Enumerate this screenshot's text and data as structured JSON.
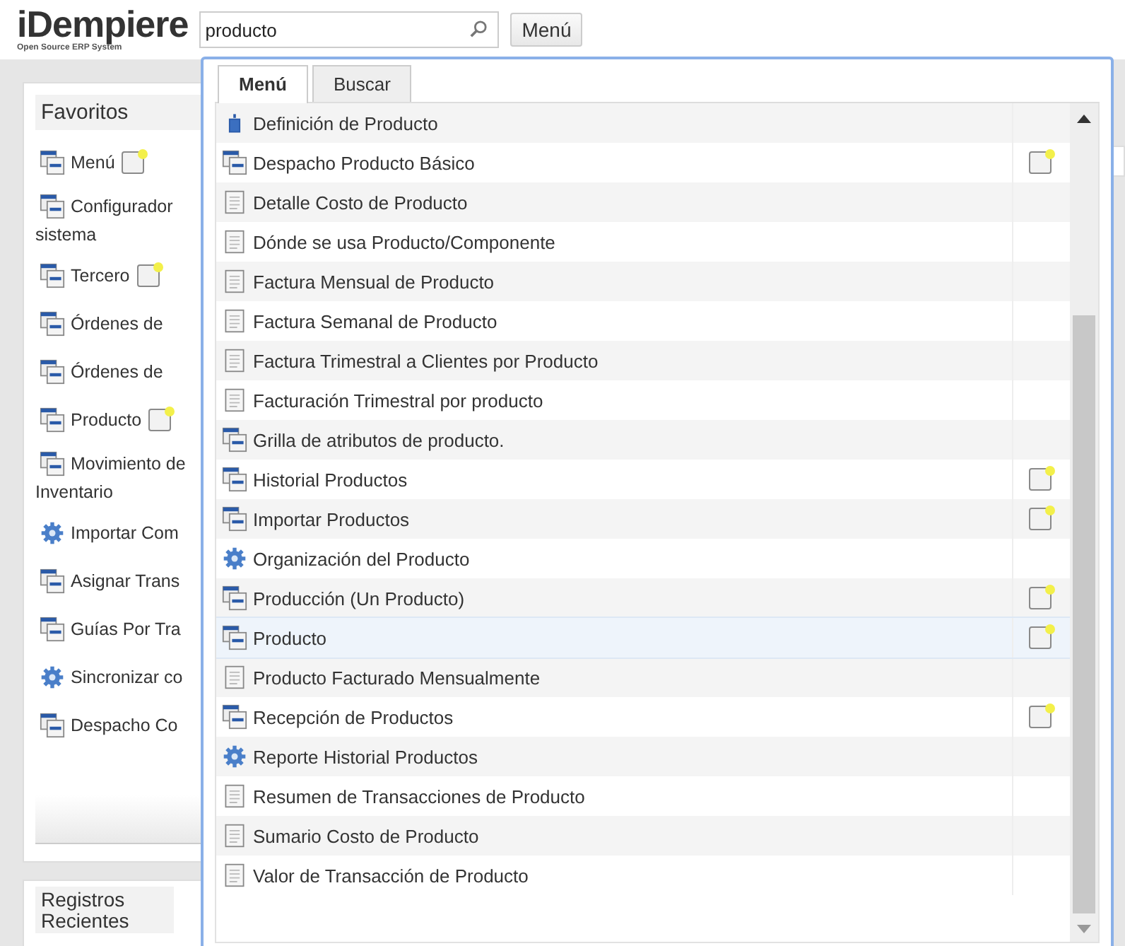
{
  "header": {
    "logo": "iDempiere",
    "logo_subtitle": "Open Source ERP System",
    "search": {
      "value": "producto"
    },
    "menu_button": "Menú"
  },
  "favorites": {
    "title": "Favoritos",
    "items": [
      {
        "kind": "window",
        "lines": [
          "Menú"
        ],
        "favorite": true
      },
      {
        "kind": "window",
        "lines": [
          "Configurador",
          "sistema"
        ],
        "favorite": false
      },
      {
        "kind": "window",
        "lines": [
          "Tercero"
        ],
        "favorite": true
      },
      {
        "kind": "window",
        "lines": [
          "Órdenes de"
        ],
        "favorite": false
      },
      {
        "kind": "window",
        "lines": [
          "Órdenes de"
        ],
        "favorite": false
      },
      {
        "kind": "window",
        "lines": [
          "Producto"
        ],
        "favorite": true
      },
      {
        "kind": "window",
        "lines": [
          "Movimiento de",
          "Inventario"
        ],
        "favorite": false
      },
      {
        "kind": "process",
        "lines": [
          "Importar Com"
        ],
        "favorite": false
      },
      {
        "kind": "window",
        "lines": [
          "Asignar Trans"
        ],
        "favorite": false
      },
      {
        "kind": "window",
        "lines": [
          "Guías Por Tra"
        ],
        "favorite": false
      },
      {
        "kind": "process",
        "lines": [
          "Sincronizar co"
        ],
        "favorite": false
      },
      {
        "kind": "window",
        "lines": [
          "Despacho Co"
        ],
        "favorite": false
      }
    ]
  },
  "recent": {
    "title": "Registros Recientes"
  },
  "popup": {
    "tabs": [
      {
        "label": "Menú",
        "selected": true
      },
      {
        "label": "Buscar",
        "selected": false
      }
    ],
    "rows": [
      {
        "kind": "form",
        "label": "Definición de Producto",
        "favorite": false,
        "selected": false
      },
      {
        "kind": "window",
        "label": "Despacho Producto Básico",
        "favorite": true,
        "selected": false
      },
      {
        "kind": "report",
        "label": "Detalle Costo de Producto",
        "favorite": false,
        "selected": false
      },
      {
        "kind": "report",
        "label": "Dónde se usa Producto/Componente",
        "favorite": false,
        "selected": false
      },
      {
        "kind": "report",
        "label": "Factura Mensual de Producto",
        "favorite": false,
        "selected": false
      },
      {
        "kind": "report",
        "label": "Factura Semanal de Producto",
        "favorite": false,
        "selected": false
      },
      {
        "kind": "report",
        "label": "Factura Trimestral a Clientes por Producto",
        "favorite": false,
        "selected": false
      },
      {
        "kind": "report",
        "label": "Facturación Trimestral por producto",
        "favorite": false,
        "selected": false
      },
      {
        "kind": "window",
        "label": "Grilla de atributos de producto.",
        "favorite": false,
        "selected": false
      },
      {
        "kind": "window",
        "label": "Historial Productos",
        "favorite": true,
        "selected": false
      },
      {
        "kind": "window",
        "label": "Importar Productos",
        "favorite": true,
        "selected": false
      },
      {
        "kind": "process",
        "label": "Organización del Producto",
        "favorite": false,
        "selected": false
      },
      {
        "kind": "window",
        "label": "Producción (Un Producto)",
        "favorite": true,
        "selected": false
      },
      {
        "kind": "window",
        "label": "Producto",
        "favorite": true,
        "selected": true
      },
      {
        "kind": "report",
        "label": "Producto Facturado Mensualmente",
        "favorite": false,
        "selected": false
      },
      {
        "kind": "window",
        "label": "Recepción de Productos",
        "favorite": true,
        "selected": false
      },
      {
        "kind": "process",
        "label": "Reporte Historial Productos",
        "favorite": false,
        "selected": false
      },
      {
        "kind": "report",
        "label": "Resumen de Transacciones de Producto",
        "favorite": false,
        "selected": false
      },
      {
        "kind": "report",
        "label": "Sumario Costo de Producto",
        "favorite": false,
        "selected": false
      },
      {
        "kind": "report",
        "label": "Valor de Transacción de Producto",
        "favorite": false,
        "selected": false
      }
    ]
  }
}
